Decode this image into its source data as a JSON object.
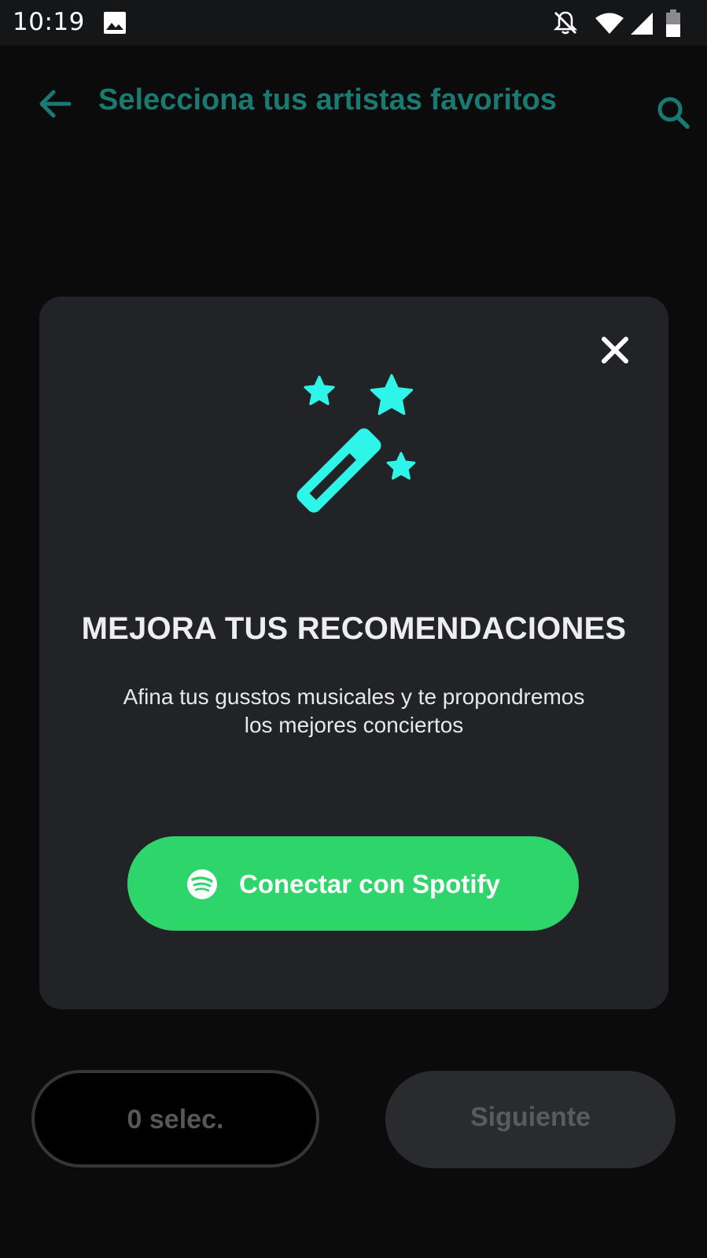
{
  "status_bar": {
    "time": "10:19",
    "icons": [
      "image-icon",
      "notifications-off-icon",
      "wifi-icon",
      "signal-icon",
      "battery-icon"
    ]
  },
  "header": {
    "title": "Selecciona tus artistas favoritos",
    "back_icon": "arrow-back-icon",
    "search_icon": "search-icon"
  },
  "modal": {
    "close_icon": "close-icon",
    "illustration_icon": "magic-wand-icon",
    "title": "MEJORA TUS RECOMENDACIONES",
    "subtitle_line1": "Afina tus gusstos musicales y te propondremos",
    "subtitle_line2": "los mejores conciertos",
    "spotify_button": {
      "label": "Conectar con Spotify",
      "icon": "spotify-logo-icon"
    }
  },
  "footer": {
    "selected_label": "0 selec.",
    "next_label": "Siguiente"
  },
  "colors": {
    "background": "#0b0b0c",
    "header_accent": "#197a72",
    "modal_background": "#222327",
    "illustration": "#2ef5e8",
    "spotify_green": "#2dd56a",
    "disabled_text": "#56575b"
  }
}
